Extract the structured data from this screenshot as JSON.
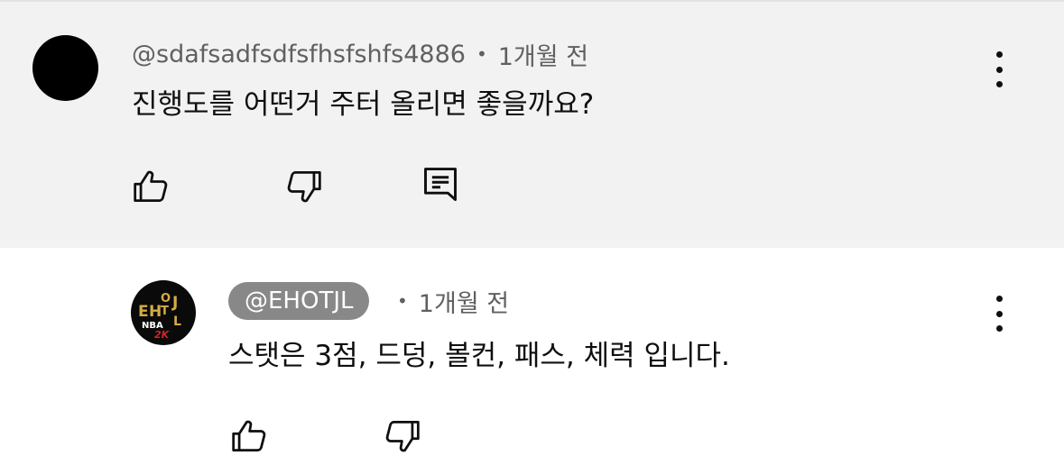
{
  "comment": {
    "author": "@sdafsadfsdfsfhsfshfs4886",
    "separator": "•",
    "time": "1개월 전",
    "text": "진행도를 어떤거 주터 올리면 좋을까요?",
    "icons": {
      "like": "thumbs-up-icon",
      "dislike": "thumbs-down-icon",
      "reply": "reply-icon",
      "menu": "more-vertical-icon"
    }
  },
  "reply": {
    "author": "@EHOTJL",
    "separator": "•",
    "time": "1개월 전",
    "text": "스탯은 3점, 드덩, 볼컨, 패스, 체력 입니다.",
    "icons": {
      "like": "thumbs-up-icon",
      "dislike": "thumbs-down-icon",
      "menu": "more-vertical-icon"
    },
    "avatar_logo": {
      "letters": [
        "E",
        "H",
        "O",
        "T",
        "J",
        "L"
      ],
      "brand": "NBA",
      "game": "2K"
    }
  },
  "colors": {
    "comment_bg": "#f2f2f2",
    "pill_bg": "#888888",
    "logo_gold": "#d4ac46",
    "logo_red": "#d2232a"
  }
}
